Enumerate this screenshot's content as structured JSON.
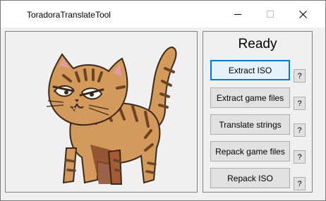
{
  "window": {
    "title": "ToradoraTranslateTool",
    "icon": "app-icon"
  },
  "controls": {
    "minimize_icon": "minimize-icon",
    "maximize_icon": "maximize-icon",
    "close_icon": "close-icon"
  },
  "picture": {
    "subject": "cat-illustration"
  },
  "panel": {
    "status": "Ready",
    "actions": [
      {
        "label": "Extract ISO",
        "help": "?"
      },
      {
        "label": "Extract game files",
        "help": "?"
      },
      {
        "label": "Translate strings",
        "help": "?"
      },
      {
        "label": "Repack game files",
        "help": "?"
      },
      {
        "label": "Repack ISO",
        "help": "?"
      }
    ]
  },
  "colors": {
    "focus_accent": "#0078d7",
    "cat_fur": "#d49a5c",
    "cat_stripes": "#6b4423",
    "cat_ear_inner": "#e39aa0"
  }
}
